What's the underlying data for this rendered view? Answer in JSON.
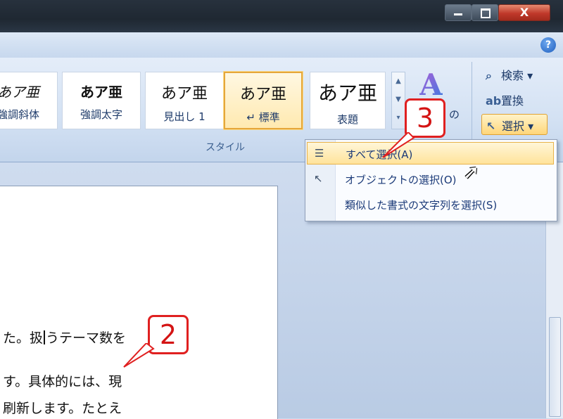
{
  "window": {
    "controls": [
      "minimize",
      "maximize",
      "close"
    ],
    "close_glyph": "X"
  },
  "help": {
    "glyph": "?"
  },
  "ribbon": {
    "styles_group_label": "スタイル",
    "style_gallery": [
      {
        "sample": "あア亜",
        "name": "強調斜体",
        "visible_name": "強調斜体"
      },
      {
        "sample": "あア亜",
        "name": "強調太字"
      },
      {
        "sample": "あア亜",
        "name": "見出し 1"
      },
      {
        "sample": "あア亜",
        "name": "↵ 標準",
        "selected": true
      },
      {
        "sample": "あア亜",
        "name": "表題"
      }
    ],
    "change_styles_label": "の",
    "editing": {
      "find_label": "検索 ▾",
      "replace_label": "置換",
      "select_label": "選択 ▾"
    }
  },
  "select_menu": {
    "items": [
      {
        "label": "すべて選択(A)",
        "icon": "select-all-icon",
        "highlighted": true
      },
      {
        "label": "オブジェクトの選択(O)",
        "icon": "pointer-icon"
      },
      {
        "label": "類似した書式の文字列を選択(S)",
        "icon": ""
      }
    ]
  },
  "document": {
    "lines": [
      {
        "before_caret": "た。扱",
        "after_caret": "うテーマ数を"
      },
      {
        "text": "す。具体的には、現"
      },
      {
        "text": "刷新します。たとえ"
      }
    ]
  },
  "callouts": {
    "step_select": "3",
    "step_caret": "2"
  },
  "colors": {
    "callout_red": "#e02020",
    "highlight": "#ffd67a",
    "ribbon": "#d3e1f3"
  }
}
